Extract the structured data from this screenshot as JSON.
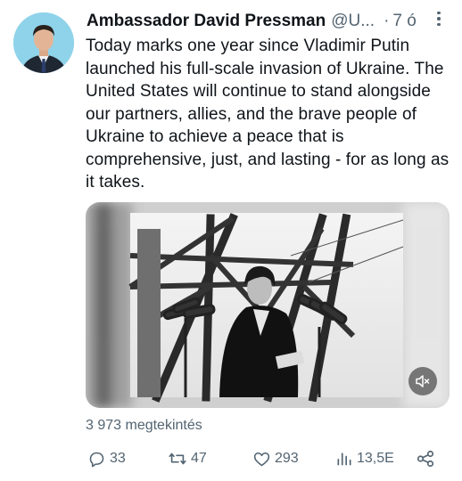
{
  "tweet": {
    "author_name": "Ambassador David Pressman",
    "handle": "@U...",
    "separator": "·",
    "time": "7 ó",
    "text": "Today marks one year since Vladimir Putin launched his full-scale invasion of Ukraine. The United States will continue to stand alongside our partners, allies, and the brave people of Ukraine to achieve a peace that is comprehensive, just, and lasting - for as long as it takes.",
    "views": "3 973 megtekintés",
    "media_type": "video (black and white)"
  },
  "actions": {
    "replies": "33",
    "retweets": "47",
    "likes": "293",
    "analytics": "13,5E"
  },
  "icons": {
    "more": "more-dots-icon",
    "mute": "volume-muted-icon",
    "reply": "reply-icon",
    "retweet": "retweet-icon",
    "like": "heart-icon",
    "analytics": "bar-chart-icon",
    "share": "share-icon"
  },
  "colors": {
    "text": "#0f1419",
    "secondary": "#536471",
    "avatar_bg": "#8fd3ea"
  }
}
